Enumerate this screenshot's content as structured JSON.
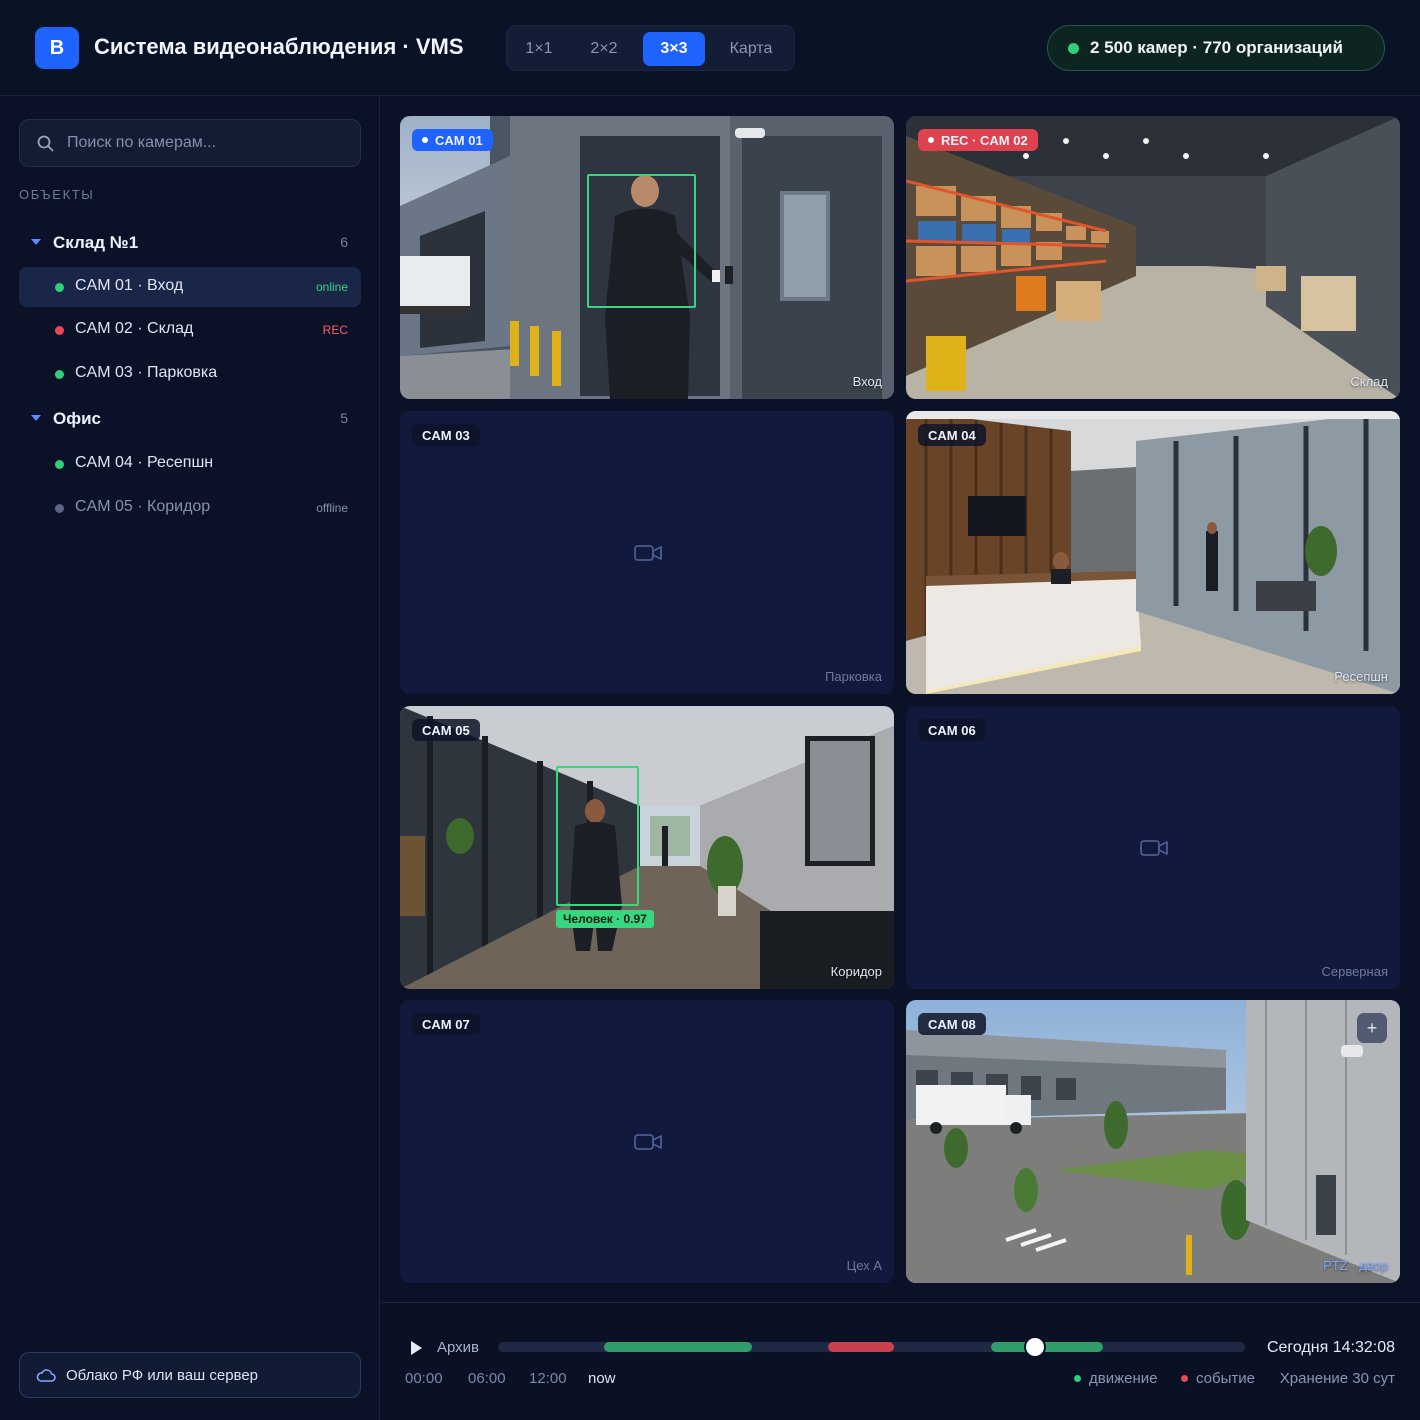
{
  "header": {
    "logo_letter": "В",
    "title": "Система видеонаблюдения · VMS",
    "layouts": [
      {
        "label": "1×1",
        "active": false
      },
      {
        "label": "2×2",
        "active": false
      },
      {
        "label": "3×3",
        "active": true
      },
      {
        "label": "Карта",
        "active": false
      }
    ],
    "stats": "2 500 камер · 770 организаций"
  },
  "sidebar": {
    "search_placeholder": "Поиск по камерам...",
    "section_label": "ОБЪЕКТЫ",
    "groups": [
      {
        "name": "Склад №1",
        "count": "6",
        "cameras": [
          {
            "name": "CAM 01 · Вход",
            "status": "online",
            "dot": "#2fd07a",
            "selected": true
          },
          {
            "name": "CAM 02 · Склад",
            "status": "REC",
            "dot": "#e8495a",
            "selected": false
          },
          {
            "name": "CAM 03 · Парковка",
            "status": "",
            "dot": "#2fd07a",
            "selected": false
          }
        ]
      },
      {
        "name": "Офис",
        "count": "5",
        "cameras": [
          {
            "name": "CAM 04 · Ресепшн",
            "status": "",
            "dot": "#2fd07a",
            "selected": false
          },
          {
            "name": "CAM 05 · Коридор",
            "status": "offline",
            "dot": "#5d6785",
            "selected": false
          }
        ]
      }
    ],
    "cloud_button": "Облако РФ или ваш сервер"
  },
  "grid": {
    "tiles": [
      {
        "label": "CAM 01",
        "location": "Вход",
        "badge": "live"
      },
      {
        "label": "REC · CAM 02",
        "location": "Склад",
        "badge": "rec"
      },
      {
        "label": "CAM 03",
        "location": "Парковка",
        "badge": "none"
      },
      {
        "label": "CAM 04",
        "location": "Ресепшн",
        "badge": "none"
      },
      {
        "label": "CAM 05",
        "location": "Коридор",
        "badge": "none",
        "detection": "Человек · 0.97"
      },
      {
        "label": "CAM 06",
        "location": "Серверная",
        "badge": "none"
      },
      {
        "label": "CAM 07",
        "location": "Цех А",
        "badge": "none"
      },
      {
        "label": "CAM 08",
        "location": "PTZ · двор",
        "badge": "none",
        "zoom_icon": "+"
      }
    ]
  },
  "timeline": {
    "archive_label": "Архив",
    "timestamp": "Сегодня 14:32:08",
    "ticks": [
      "00:00",
      "06:00",
      "12:00",
      "now"
    ],
    "legend": [
      {
        "label": "движение",
        "color": "#2fd07a"
      },
      {
        "label": "событие",
        "color": "#e8495a"
      }
    ],
    "retention": "Хранение 30 сут",
    "colors": {
      "motion": "#2f9e6a",
      "event": "#c9404f",
      "track": "#1f2945"
    }
  }
}
